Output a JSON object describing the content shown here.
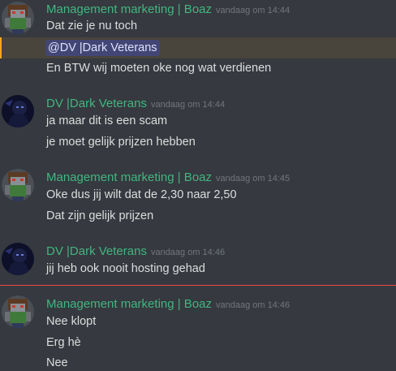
{
  "colors": {
    "background": "#36393f",
    "boaz_name": "#43b581",
    "dv_name": "#43b581",
    "mention_bg": "#414675",
    "mention_highlight": "#49443c",
    "new_divider": "#f04747"
  },
  "groups": [
    {
      "author": "Management marketing | Boaz",
      "timestamp": "vandaag om 14:44",
      "avatar": "minecraft-skin-avatar",
      "messages": [
        "Dat zie je nu toch",
        "@DV |Dark Veterans",
        "En BTW wij moeten oke nog wat verdienen"
      ]
    },
    {
      "author": "DV |Dark Veterans",
      "timestamp": "vandaag om 14:44",
      "avatar": "dark-character-avatar",
      "messages": [
        "ja maar dit is een scam",
        "je moet gelijk prijzen hebben"
      ]
    },
    {
      "author": "Management marketing | Boaz",
      "timestamp": "vandaag om 14:45",
      "avatar": "minecraft-skin-avatar",
      "messages": [
        "Oke dus jij wilt dat de 2,30 naar 2,50",
        "Dat zijn gelijk prijzen"
      ]
    },
    {
      "author": "DV |Dark Veterans",
      "timestamp": "vandaag om 14:46",
      "avatar": "dark-character-avatar",
      "messages": [
        "jij heb ook nooit hosting gehad"
      ]
    },
    {
      "author": "Management marketing | Boaz",
      "timestamp": "vandaag om 14:46",
      "avatar": "minecraft-skin-avatar",
      "messages": [
        "Nee klopt",
        "Erg hè",
        "Nee"
      ]
    }
  ]
}
